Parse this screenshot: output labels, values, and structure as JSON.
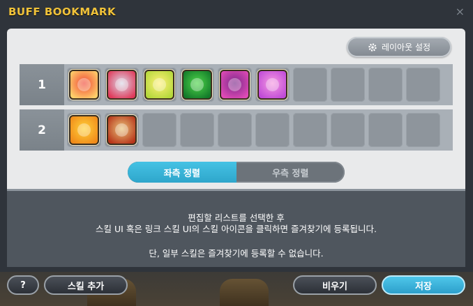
{
  "window": {
    "title": "BUFF BOOKMARK",
    "close_glyph": "×"
  },
  "layout_button": {
    "label": "레이아웃 설정",
    "icon": "gear-icon"
  },
  "rows": [
    {
      "number": "1",
      "skills": [
        {
          "icon": "red-crest-buff-icon",
          "color1": "#f04a3a",
          "color2": "#ffd06a"
        },
        {
          "icon": "ring-buff-icon",
          "color1": "#d9d9e8",
          "color2": "#e03a5a"
        },
        {
          "icon": "yellow-wings-buff-icon",
          "color1": "#fff07a",
          "color2": "#b4d83a"
        },
        {
          "icon": "green-eye-buff-icon",
          "color1": "#4fd64a",
          "color2": "#137a2a"
        },
        {
          "icon": "purple-eye-buff-icon",
          "color1": "#7a2a8a",
          "color2": "#e04ab6"
        },
        {
          "icon": "pink-spirit-buff-icon",
          "color1": "#f59ae0",
          "color2": "#c04ad8"
        }
      ],
      "empty_count": 4
    },
    {
      "number": "2",
      "skills": [
        {
          "icon": "golden-flame-buff-icon",
          "color1": "#ffd23a",
          "color2": "#f08a1a"
        },
        {
          "icon": "phoenix-buff-icon",
          "color1": "#e8c27a",
          "color2": "#b8361a"
        }
      ],
      "empty_count": 8
    }
  ],
  "alignment": {
    "left_label": "좌측 정렬",
    "right_label": "우측 정렬",
    "selected": "left"
  },
  "info": {
    "line1": "편집할 리스트를 선택한 후",
    "line2": "스킬 UI 혹은 링크 스킬 UI의 스킬 아이콘을 클릭하면 즐겨찾기에 등록됩니다.",
    "line3": "단, 일부 스킬은 즐겨찾기에 등록할 수 없습니다."
  },
  "footer": {
    "help_label": "?",
    "add_skill_label": "스킬 추가",
    "clear_label": "비우기",
    "save_label": "저장"
  },
  "colors": {
    "title": "#f0c23a",
    "accent": "#35b2d8"
  }
}
